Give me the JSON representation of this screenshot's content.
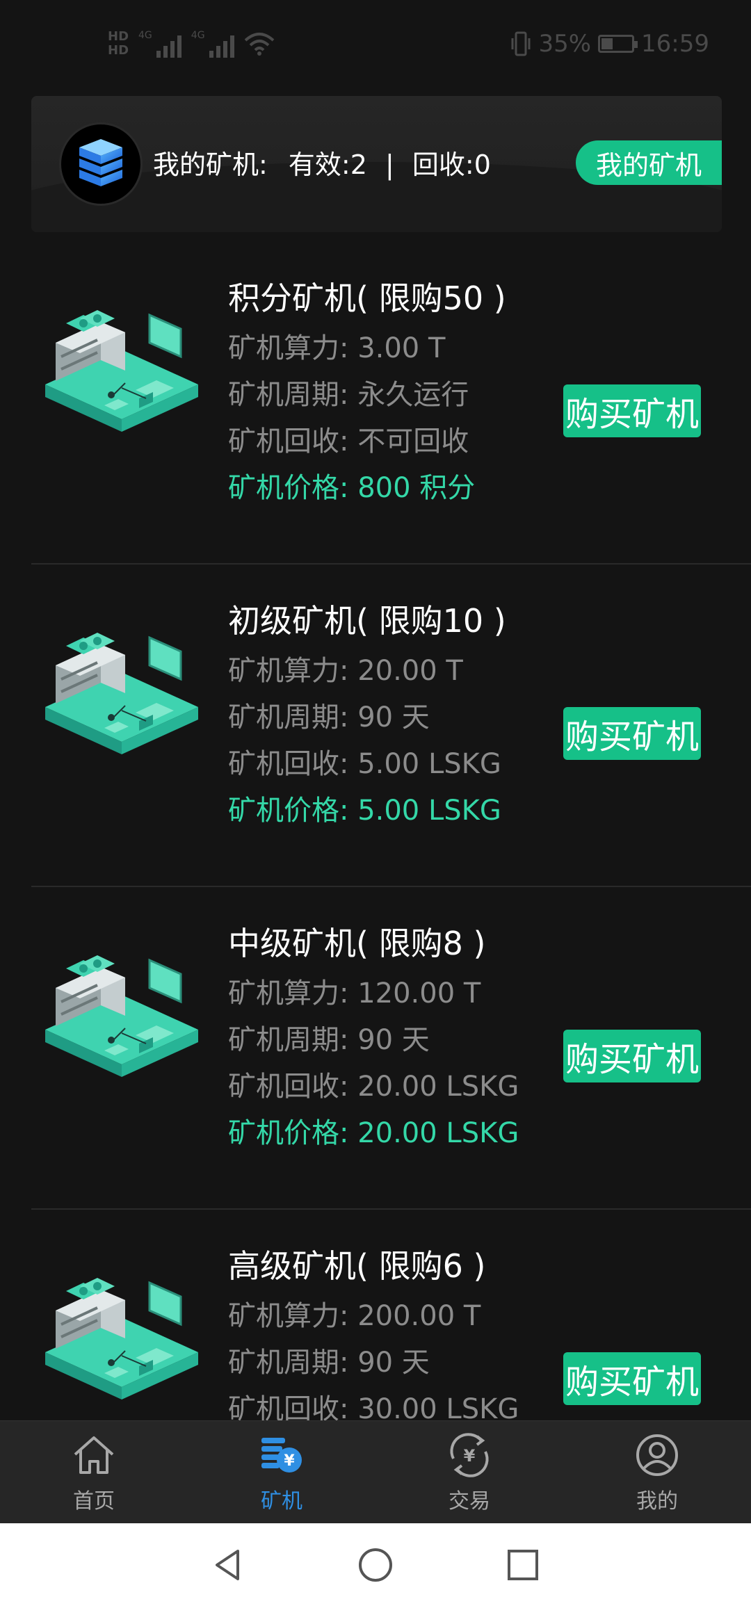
{
  "status_bar": {
    "hd_labels": [
      "HD",
      "HD"
    ],
    "net_labels": [
      "4G",
      "4G"
    ],
    "battery_percent": "35%",
    "time": "16:59"
  },
  "summary": {
    "prefix": "我的矿机:",
    "valid_label": "有效:",
    "valid_count": "2",
    "separator": "|",
    "recycle_label": "回收:",
    "recycle_count": "0",
    "button_label": "我的矿机"
  },
  "miners": [
    {
      "title": "积分矿机( 限购50 )",
      "power": "矿机算力: 3.00 T",
      "period": "矿机周期: 永久运行",
      "recycle": "矿机回收: 不可回收",
      "price": "矿机价格: 800 积分",
      "buy_label": "购买矿机"
    },
    {
      "title": "初级矿机( 限购10 )",
      "power": "矿机算力: 20.00 T",
      "period": "矿机周期: 90 天",
      "recycle": "矿机回收: 5.00 LSKG",
      "price": "矿机价格: 5.00 LSKG",
      "buy_label": "购买矿机"
    },
    {
      "title": "中级矿机( 限购8 )",
      "power": "矿机算力: 120.00 T",
      "period": "矿机周期: 90 天",
      "recycle": "矿机回收: 20.00 LSKG",
      "price": "矿机价格: 20.00 LSKG",
      "buy_label": "购买矿机"
    },
    {
      "title": "高级矿机( 限购6 )",
      "power": "矿机算力: 200.00 T",
      "period": "矿机周期: 90 天",
      "recycle": "矿机回收: 30.00 LSKG",
      "price": "",
      "buy_label": "购买矿机"
    }
  ],
  "tabs": [
    {
      "label": "首页",
      "icon": "home-icon",
      "active": false
    },
    {
      "label": "矿机",
      "icon": "miner-icon",
      "active": true
    },
    {
      "label": "交易",
      "icon": "trade-icon",
      "active": false
    },
    {
      "label": "我的",
      "icon": "profile-icon",
      "active": false
    }
  ],
  "colors": {
    "accent": "#16c088",
    "price_text": "#34d8a8",
    "active_tab": "#2f8fe3",
    "background": "#141414"
  }
}
